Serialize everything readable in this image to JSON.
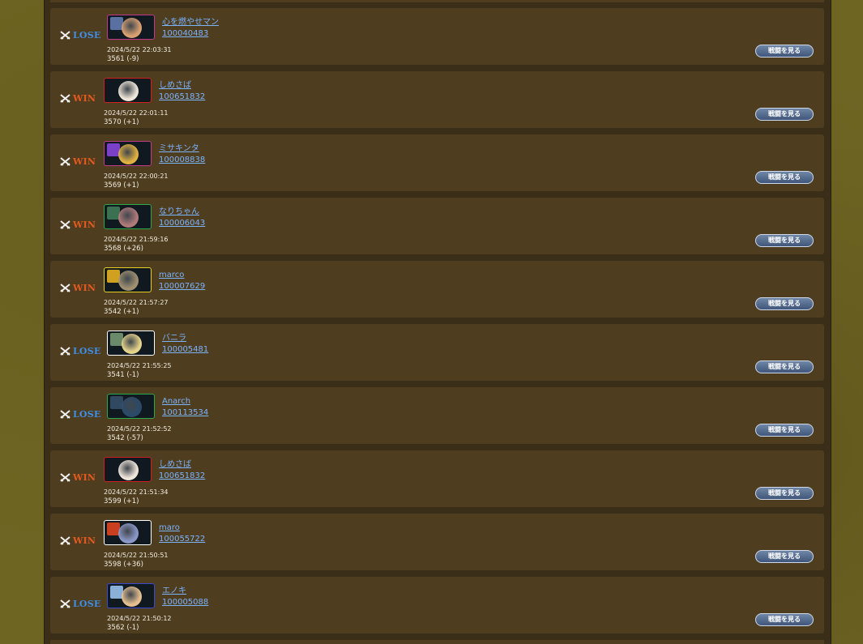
{
  "battle_log": {
    "view_button_label": "戦闘を見る",
    "entries": [
      {
        "result": "LOSE",
        "name": "心を燃やせマン",
        "user_id": "100040483",
        "datetime": "2024/5/22 22:03:31",
        "score": "3561 (-9)",
        "frame_color": "#c23a8a",
        "face_color": "#d9a070",
        "side_color": "#5a70a0"
      },
      {
        "result": "WIN",
        "name": "しめさば",
        "user_id": "100651832",
        "datetime": "2024/5/22 22:01:11",
        "score": "3570 (+1)",
        "frame_color": "#d02020",
        "face_color": "#efe6da",
        "side_color": "#101820"
      },
      {
        "result": "WIN",
        "name": "ミサキンタ",
        "user_id": "100008838",
        "datetime": "2024/5/22 22:00:21",
        "score": "3569 (+1)",
        "frame_color": "#c23a8a",
        "face_color": "#e0b040",
        "side_color": "#7a40c8"
      },
      {
        "result": "WIN",
        "name": "なりちゃん",
        "user_id": "100006043",
        "datetime": "2024/5/22 21:59:16",
        "score": "3568 (+26)",
        "frame_color": "#2aa84a",
        "face_color": "#b07a7a",
        "side_color": "#3b7050"
      },
      {
        "result": "WIN",
        "name": "marco",
        "user_id": "100007629",
        "datetime": "2024/5/22 21:57:27",
        "score": "3542 (+1)",
        "frame_color": "#e8d020",
        "face_color": "#a09070",
        "side_color": "#d0a020"
      },
      {
        "result": "LOSE",
        "name": "バニラ",
        "user_id": "100005481",
        "datetime": "2024/5/22 21:55:25",
        "score": "3541 (-1)",
        "frame_color": "#ffffff",
        "face_color": "#e6d48a",
        "side_color": "#6a8a6a"
      },
      {
        "result": "LOSE",
        "name": "Anarch",
        "user_id": "100113534",
        "datetime": "2024/5/22 21:52:52",
        "score": "3542 (-57)",
        "frame_color": "#2aa84a",
        "face_color": "#2a4a6a",
        "side_color": "#304860"
      },
      {
        "result": "WIN",
        "name": "しめさば",
        "user_id": "100651832",
        "datetime": "2024/5/22 21:51:34",
        "score": "3599 (+1)",
        "frame_color": "#d02020",
        "face_color": "#efe6da",
        "side_color": "#101820"
      },
      {
        "result": "WIN",
        "name": "maro",
        "user_id": "100055722",
        "datetime": "2024/5/22 21:50:51",
        "score": "3598 (+36)",
        "frame_color": "#ffffff",
        "face_color": "#8a98c8",
        "side_color": "#c84020"
      },
      {
        "result": "LOSE",
        "name": "エノキ",
        "user_id": "100005088",
        "datetime": "2024/5/22 21:50:12",
        "score": "3562 (-1)",
        "frame_color": "#3a4ad0",
        "face_color": "#e6c090",
        "side_color": "#8ab0d8"
      }
    ]
  }
}
